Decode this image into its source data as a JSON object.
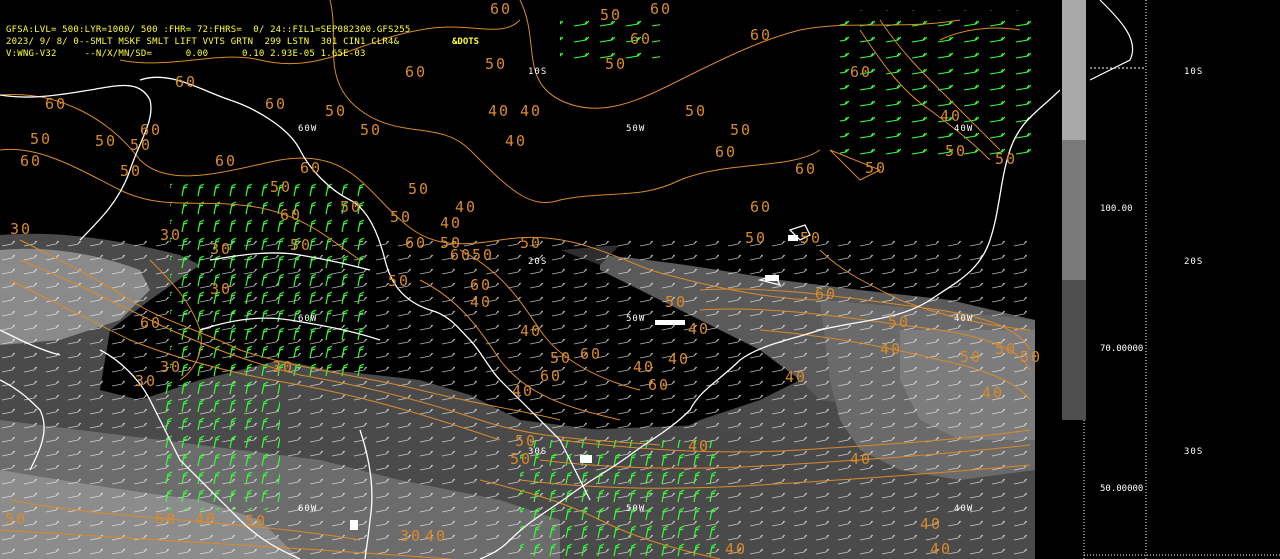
{
  "header": {
    "line1": "GFSA:LVL= 500:LYR=1000/ 500 :FHR= 72:FHRS=  0/ 24::FIL1=SEP082300.GFS255",
    "line2": "2023/ 9/ 8/ 0--SMLT MSKF SMLT LIFT VVTS GRTN  299 LSTN  301 CIN1 CLR4&",
    "line3": "V:WNG-V32     --N/X/MN/SD=      0.00      0.10 2.93E-05 1.65E-03",
    "dots_tag": "&DOTS"
  },
  "grid_labels": [
    "10S",
    "20S",
    "30S",
    "60W",
    "50W",
    "40W"
  ],
  "contour_labels": [
    "60",
    "50",
    "40",
    "30"
  ],
  "scale": {
    "labels": [
      "100.00",
      "70.00000",
      "50.00000"
    ],
    "colors": [
      "#dcdcdc",
      "#a8a8a8",
      "#7a7a7a",
      "#4e4e4e"
    ]
  },
  "colors": {
    "contour": "#d98a2b",
    "wind_barb": "#33ff33",
    "coastline": "#ffffff",
    "header_text": "#ffff33"
  }
}
